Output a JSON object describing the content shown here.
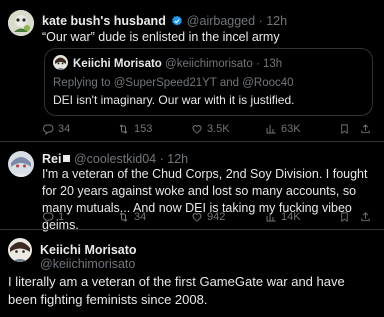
{
  "tweet1": {
    "name": "kate bush's husband",
    "handle": "@airbagged",
    "sep": "·",
    "time": "12h",
    "text": "“Our war” dude is enlisted in the incel army",
    "quote": {
      "name": "Keiichi Morisato",
      "handle": "@keiichimorisato",
      "sep": "·",
      "time": "13h",
      "reply_prefix": "Replying to ",
      "reply_handle_1": "@SuperSpeed21YT",
      "reply_and": " and ",
      "reply_handle_2": "@Rooc40",
      "text": "DEI isn't imaginary. Our war with it is justified."
    },
    "actions": {
      "replies": "34",
      "reposts": "153",
      "likes": "3.5K",
      "views": "63K"
    }
  },
  "tweet2": {
    "name": "Rei",
    "handle": "@coolestkid04",
    "sep": "·",
    "time": "12h",
    "text": "I'm a veteran of the Chud Corps, 2nd Soy Division. I fought for 20 years against woke and lost so many accounts, so many mutuals... And now DEI is taking my fucking vibeo geims.",
    "actions": {
      "replies": "1",
      "reposts": "34",
      "likes": "942",
      "views": "14K"
    }
  },
  "tweet3": {
    "name": "Keiichi Morisato",
    "handle": "@keiichimorisato",
    "text": "I literally am a veteran of the first GameGate war and have been fighting feminists since 2008."
  },
  "colors": {
    "background": "#000000",
    "text": "#e7e9ea",
    "muted": "#71767b",
    "verified": "#1d9bf0",
    "border": "#2f3336"
  },
  "icons": [
    "reply-icon",
    "repost-icon",
    "like-icon",
    "views-icon",
    "bookmark-icon",
    "share-icon",
    "verified-badge-icon"
  ]
}
